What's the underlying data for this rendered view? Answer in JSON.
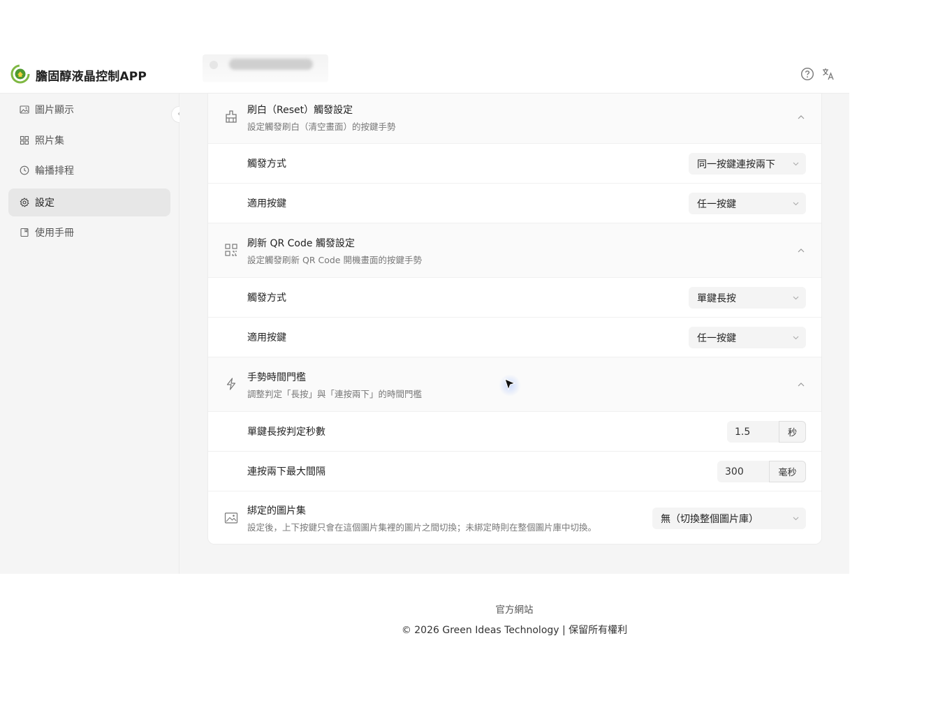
{
  "app": {
    "title": "膽固醇液晶控制APP"
  },
  "header": {
    "help_icon": "help-circle-icon",
    "lang_icon": "translate-icon"
  },
  "sidebar": {
    "items": [
      {
        "label": "圖片顯示",
        "icon": "image-icon",
        "active": false
      },
      {
        "label": "照片集",
        "icon": "grid-icon",
        "active": false
      },
      {
        "label": "輪播排程",
        "icon": "clock-icon",
        "active": false
      },
      {
        "label": "設定",
        "icon": "gear-icon",
        "active": true
      },
      {
        "label": "使用手冊",
        "icon": "book-icon",
        "active": false
      }
    ]
  },
  "sections": {
    "reset": {
      "title": "刷白（Reset）觸發設定",
      "desc": "設定觸發刷白（清空畫面）的按鍵手勢",
      "trigger_label": "觸發方式",
      "trigger_value": "同一按鍵連按兩下",
      "keys_label": "適用按鍵",
      "keys_value": "任一按鍵"
    },
    "qr": {
      "title": "刷新 QR Code 觸發設定",
      "desc": "設定觸發刷新 QR Code 開機畫面的按鍵手勢",
      "trigger_label": "觸發方式",
      "trigger_value": "單鍵長按",
      "keys_label": "適用按鍵",
      "keys_value": "任一按鍵"
    },
    "gesture": {
      "title": "手勢時間門檻",
      "desc": "調整判定「長按」與「連按兩下」的時間門檻",
      "long_press_label": "單鍵長按判定秒數",
      "long_press_value": "1.5",
      "long_press_unit": "秒",
      "double_label": "連按兩下最大間隔",
      "double_value": "300",
      "double_unit": "毫秒"
    },
    "album": {
      "title": "綁定的圖片集",
      "desc": "設定後，上下按鍵只會在這個圖片集裡的圖片之間切換；未綁定時則在整個圖片庫中切換。",
      "value": "無（切換整個圖片庫）"
    }
  },
  "footer": {
    "link": "官方網站",
    "copyright": "© 2026 Green Ideas Technology | 保留所有權利"
  }
}
